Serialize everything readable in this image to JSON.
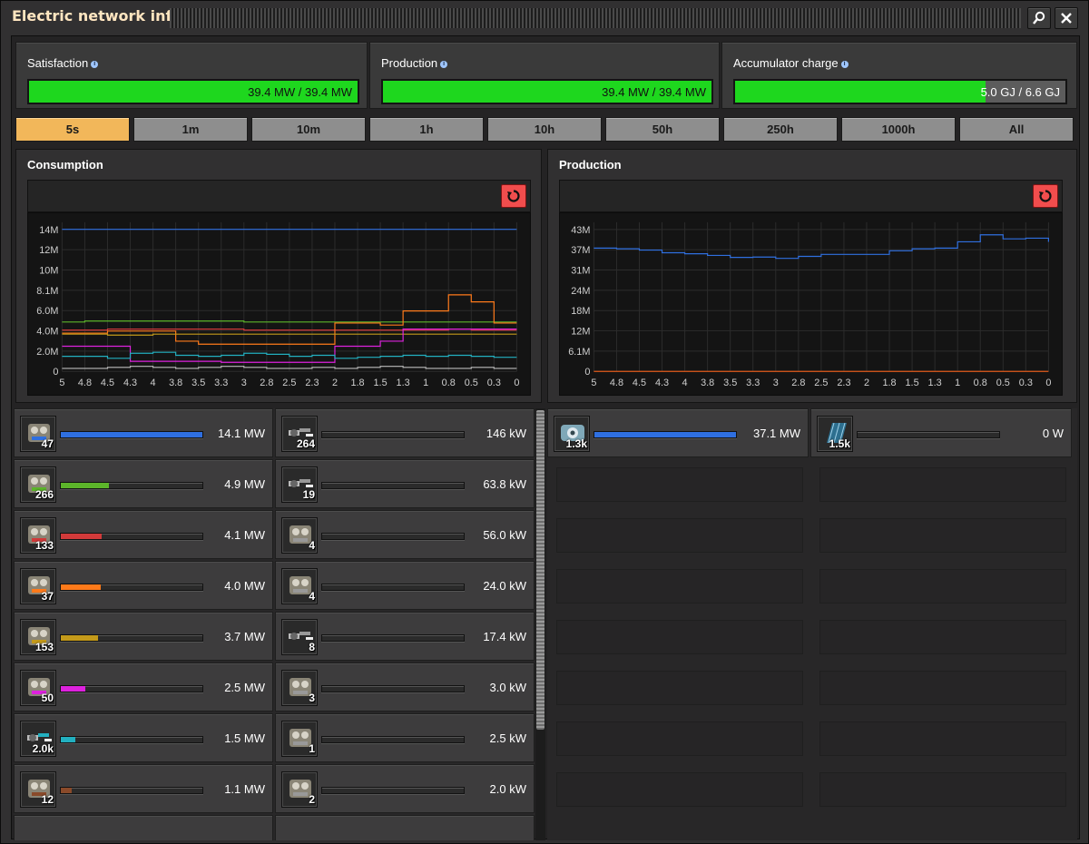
{
  "window": {
    "title": "Electric network info"
  },
  "summary": {
    "satisfaction": {
      "label": "Satisfaction",
      "value": "39.4 MW / 39.4 MW",
      "fill_fraction": 1.0
    },
    "production": {
      "label": "Production",
      "value": "39.4 MW / 39.4 MW",
      "fill_fraction": 1.0
    },
    "accumulator": {
      "label": "Accumulator charge",
      "value": "5.0 GJ / 6.6 GJ",
      "fill_fraction": 0.757
    }
  },
  "time_tabs": [
    "5s",
    "1m",
    "10m",
    "1h",
    "10h",
    "50h",
    "250h",
    "1000h",
    "All"
  ],
  "active_tab": "5s",
  "colors": {
    "green_bar": "#1ed71e",
    "tab_active": "#f2b75a",
    "reset_button": "#f14d4d"
  },
  "chart_data": [
    {
      "type": "line",
      "title": "Consumption",
      "x": [
        5,
        4.8,
        4.5,
        4.3,
        4,
        3.8,
        3.5,
        3.3,
        3,
        2.8,
        2.5,
        2.3,
        2,
        1.8,
        1.5,
        1.3,
        1,
        0.8,
        0.5,
        0.3,
        0
      ],
      "x_tick_labels": [
        "5",
        "4.8",
        "4.5",
        "4.3",
        "4",
        "3.8",
        "3.5",
        "3.3",
        "3",
        "2.8",
        "2.5",
        "2.3",
        "2",
        "1.8",
        "1.5",
        "1.3",
        "1",
        "0.8",
        "0.5",
        "0.3",
        "0"
      ],
      "y_tick_labels": [
        "0",
        "2.0M",
        "4.0M",
        "6.0M",
        "8.1M",
        "10M",
        "12M",
        "14M"
      ],
      "ylim": [
        0,
        14800000
      ],
      "grid": true,
      "series": [
        {
          "color": "#2f6fe0",
          "values": [
            14100000,
            14100000,
            14100000,
            14100000,
            14100000,
            14100000,
            14100000,
            14100000,
            14100000,
            14100000,
            14100000,
            14100000,
            14100000,
            14100000,
            14100000,
            14100000,
            14100000,
            14100000,
            14100000,
            14100000,
            14100000
          ]
        },
        {
          "color": "#5cb52a",
          "values": [
            4900000,
            5000000,
            5000000,
            5000000,
            5000000,
            5000000,
            5000000,
            5000000,
            4900000,
            4900000,
            4900000,
            4900000,
            4900000,
            4900000,
            4900000,
            4900000,
            4900000,
            4900000,
            4900000,
            4900000,
            4900000
          ]
        },
        {
          "color": "#d23a3a",
          "values": [
            4100000,
            4100000,
            4200000,
            4200000,
            4200000,
            4200000,
            4200000,
            4200000,
            4100000,
            4100000,
            4100000,
            4100000,
            4100000,
            4100000,
            4100000,
            4100000,
            4100000,
            4200000,
            4100000,
            4100000,
            4100000
          ]
        },
        {
          "color": "#ff7a1a",
          "values": [
            3800000,
            3800000,
            4000000,
            4000000,
            4000000,
            3000000,
            2700000,
            2700000,
            2700000,
            2700000,
            2700000,
            2700000,
            4800000,
            4800000,
            4600000,
            6000000,
            6000000,
            7600000,
            6900000,
            4800000,
            4800000
          ]
        },
        {
          "color": "#c49a1a",
          "values": [
            3700000,
            3700000,
            3600000,
            3600000,
            3700000,
            3700000,
            3700000,
            3700000,
            3700000,
            3700000,
            3700000,
            3700000,
            3700000,
            3700000,
            3700000,
            3700000,
            3700000,
            3700000,
            3700000,
            3700000,
            3700000
          ]
        },
        {
          "color": "#dd22dd",
          "values": [
            2500000,
            2500000,
            2500000,
            1000000,
            1000000,
            1000000,
            1000000,
            900000,
            900000,
            900000,
            900000,
            900000,
            2500000,
            2500000,
            3000000,
            4200000,
            4200000,
            4200000,
            4200000,
            4200000,
            4200000
          ]
        },
        {
          "color": "#22b0c0",
          "values": [
            1500000,
            1500000,
            1300000,
            1800000,
            1900000,
            1600000,
            1500000,
            1600000,
            1800000,
            1700000,
            1500000,
            1600000,
            1300000,
            1400000,
            1500000,
            1600000,
            1500000,
            1600000,
            1500000,
            1400000,
            1400000
          ]
        },
        {
          "color": "#bbbbbb",
          "values": [
            300000,
            300000,
            400000,
            500000,
            400000,
            300000,
            400000,
            500000,
            400000,
            300000,
            300000,
            400000,
            300000,
            400000,
            500000,
            400000,
            300000,
            300000,
            400000,
            300000,
            300000
          ]
        }
      ]
    },
    {
      "type": "line",
      "title": "Production",
      "x": [
        5,
        4.8,
        4.5,
        4.3,
        4,
        3.8,
        3.5,
        3.3,
        3,
        2.8,
        2.5,
        2.3,
        2,
        1.8,
        1.5,
        1.3,
        1,
        0.8,
        0.5,
        0.3,
        0
      ],
      "x_tick_labels": [
        "5",
        "4.8",
        "4.5",
        "4.3",
        "4",
        "3.8",
        "3.5",
        "3.3",
        "3",
        "2.8",
        "2.5",
        "2.3",
        "2",
        "1.8",
        "1.5",
        "1.3",
        "1",
        "0.8",
        "0.5",
        "0.3",
        "0"
      ],
      "y_tick_labels": [
        "0",
        "6.1M",
        "12M",
        "18M",
        "24M",
        "31M",
        "37M",
        "43M"
      ],
      "ylim": [
        0,
        45000000
      ],
      "grid": true,
      "series": [
        {
          "color": "#2f6fe0",
          "values": [
            37200000,
            37000000,
            36600000,
            35800000,
            35500000,
            35000000,
            34400000,
            34500000,
            34100000,
            34700000,
            35300000,
            35300000,
            35300000,
            36400000,
            37000000,
            37200000,
            39100000,
            41200000,
            40000000,
            40200000,
            39100000
          ]
        },
        {
          "color": "#e05a1a",
          "values": [
            0,
            0,
            0,
            0,
            0,
            0,
            0,
            0,
            0,
            0,
            0,
            0,
            0,
            0,
            0,
            0,
            0,
            0,
            0,
            0,
            0
          ]
        }
      ]
    }
  ],
  "consumers": {
    "left": [
      {
        "icon": "assembler-icon",
        "count": "47",
        "value": "14.1 MW",
        "fill_fraction": 1.0,
        "color": "#2f6fe0"
      },
      {
        "icon": "chemical-plant-icon",
        "count": "266",
        "value": "4.9 MW",
        "fill_fraction": 0.34,
        "color": "#5cb52a"
      },
      {
        "icon": "electric-furnace-icon",
        "count": "133",
        "value": "4.1 MW",
        "fill_fraction": 0.29,
        "color": "#d23a3a"
      },
      {
        "icon": "centrifuge-icon",
        "count": "37",
        "value": "4.0 MW",
        "fill_fraction": 0.28,
        "color": "#ff7a1a"
      },
      {
        "icon": "pump-icon",
        "count": "153",
        "value": "3.7 MW",
        "fill_fraction": 0.26,
        "color": "#c49a1a"
      },
      {
        "icon": "oil-refinery-icon",
        "count": "50",
        "value": "2.5 MW",
        "fill_fraction": 0.17,
        "color": "#dd22dd"
      },
      {
        "icon": "filter-inserter-icon",
        "count": "2.0k",
        "value": "1.5 MW",
        "fill_fraction": 0.1,
        "color": "#22b0c0"
      },
      {
        "icon": "pumpjack-icon",
        "count": "12",
        "value": "1.1 MW",
        "fill_fraction": 0.08,
        "color": "#8a4a2a"
      }
    ],
    "right": [
      {
        "icon": "long-inserter-icon",
        "count": "264",
        "value": "146 kW",
        "fill_fraction": 0.0,
        "color": "#999999"
      },
      {
        "icon": "fast-inserter-icon",
        "count": "19",
        "value": "63.8 kW",
        "fill_fraction": 0.0,
        "color": "#999999"
      },
      {
        "icon": "lab-icon",
        "count": "4",
        "value": "56.0 kW",
        "fill_fraction": 0.0,
        "color": "#999999"
      },
      {
        "icon": "roboport-icon",
        "count": "4",
        "value": "24.0 kW",
        "fill_fraction": 0.0,
        "color": "#999999"
      },
      {
        "icon": "stack-inserter-icon",
        "count": "8",
        "value": "17.4 kW",
        "fill_fraction": 0.0,
        "color": "#999999"
      },
      {
        "icon": "radar-icon",
        "count": "3",
        "value": "3.0 kW",
        "fill_fraction": 0.0,
        "color": "#999999"
      },
      {
        "icon": "crafting-machine-icon",
        "count": "1",
        "value": "2.5 kW",
        "fill_fraction": 0.0,
        "color": "#999999"
      },
      {
        "icon": "programmable-speaker-icon",
        "count": "2",
        "value": "2.0 kW",
        "fill_fraction": 0.0,
        "color": "#999999"
      }
    ]
  },
  "producers": [
    {
      "icon": "steam-turbine-icon",
      "count": "1.3k",
      "value": "37.1 MW",
      "fill_fraction": 1.0,
      "color": "#2f6fe0"
    },
    {
      "icon": "solar-panel-icon",
      "count": "1.5k",
      "value": "0 W",
      "fill_fraction": 0.0,
      "color": "#999999"
    }
  ]
}
